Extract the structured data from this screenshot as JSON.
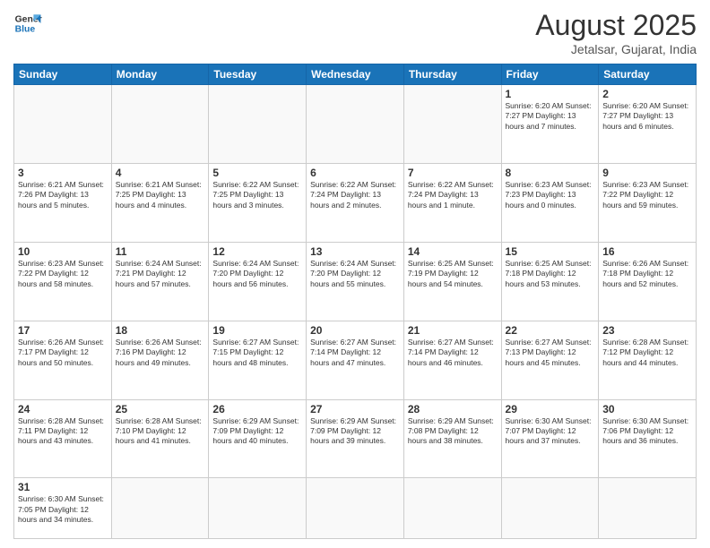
{
  "header": {
    "logo": {
      "general": "General",
      "blue": "Blue"
    },
    "title": "August 2025",
    "location": "Jetalsar, Gujarat, India"
  },
  "calendar": {
    "days_of_week": [
      "Sunday",
      "Monday",
      "Tuesday",
      "Wednesday",
      "Thursday",
      "Friday",
      "Saturday"
    ],
    "weeks": [
      [
        {
          "day": "",
          "info": ""
        },
        {
          "day": "",
          "info": ""
        },
        {
          "day": "",
          "info": ""
        },
        {
          "day": "",
          "info": ""
        },
        {
          "day": "",
          "info": ""
        },
        {
          "day": "1",
          "info": "Sunrise: 6:20 AM\nSunset: 7:27 PM\nDaylight: 13 hours and 7 minutes."
        },
        {
          "day": "2",
          "info": "Sunrise: 6:20 AM\nSunset: 7:27 PM\nDaylight: 13 hours and 6 minutes."
        }
      ],
      [
        {
          "day": "3",
          "info": "Sunrise: 6:21 AM\nSunset: 7:26 PM\nDaylight: 13 hours and 5 minutes."
        },
        {
          "day": "4",
          "info": "Sunrise: 6:21 AM\nSunset: 7:25 PM\nDaylight: 13 hours and 4 minutes."
        },
        {
          "day": "5",
          "info": "Sunrise: 6:22 AM\nSunset: 7:25 PM\nDaylight: 13 hours and 3 minutes."
        },
        {
          "day": "6",
          "info": "Sunrise: 6:22 AM\nSunset: 7:24 PM\nDaylight: 13 hours and 2 minutes."
        },
        {
          "day": "7",
          "info": "Sunrise: 6:22 AM\nSunset: 7:24 PM\nDaylight: 13 hours and 1 minute."
        },
        {
          "day": "8",
          "info": "Sunrise: 6:23 AM\nSunset: 7:23 PM\nDaylight: 13 hours and 0 minutes."
        },
        {
          "day": "9",
          "info": "Sunrise: 6:23 AM\nSunset: 7:22 PM\nDaylight: 12 hours and 59 minutes."
        }
      ],
      [
        {
          "day": "10",
          "info": "Sunrise: 6:23 AM\nSunset: 7:22 PM\nDaylight: 12 hours and 58 minutes."
        },
        {
          "day": "11",
          "info": "Sunrise: 6:24 AM\nSunset: 7:21 PM\nDaylight: 12 hours and 57 minutes."
        },
        {
          "day": "12",
          "info": "Sunrise: 6:24 AM\nSunset: 7:20 PM\nDaylight: 12 hours and 56 minutes."
        },
        {
          "day": "13",
          "info": "Sunrise: 6:24 AM\nSunset: 7:20 PM\nDaylight: 12 hours and 55 minutes."
        },
        {
          "day": "14",
          "info": "Sunrise: 6:25 AM\nSunset: 7:19 PM\nDaylight: 12 hours and 54 minutes."
        },
        {
          "day": "15",
          "info": "Sunrise: 6:25 AM\nSunset: 7:18 PM\nDaylight: 12 hours and 53 minutes."
        },
        {
          "day": "16",
          "info": "Sunrise: 6:26 AM\nSunset: 7:18 PM\nDaylight: 12 hours and 52 minutes."
        }
      ],
      [
        {
          "day": "17",
          "info": "Sunrise: 6:26 AM\nSunset: 7:17 PM\nDaylight: 12 hours and 50 minutes."
        },
        {
          "day": "18",
          "info": "Sunrise: 6:26 AM\nSunset: 7:16 PM\nDaylight: 12 hours and 49 minutes."
        },
        {
          "day": "19",
          "info": "Sunrise: 6:27 AM\nSunset: 7:15 PM\nDaylight: 12 hours and 48 minutes."
        },
        {
          "day": "20",
          "info": "Sunrise: 6:27 AM\nSunset: 7:14 PM\nDaylight: 12 hours and 47 minutes."
        },
        {
          "day": "21",
          "info": "Sunrise: 6:27 AM\nSunset: 7:14 PM\nDaylight: 12 hours and 46 minutes."
        },
        {
          "day": "22",
          "info": "Sunrise: 6:27 AM\nSunset: 7:13 PM\nDaylight: 12 hours and 45 minutes."
        },
        {
          "day": "23",
          "info": "Sunrise: 6:28 AM\nSunset: 7:12 PM\nDaylight: 12 hours and 44 minutes."
        }
      ],
      [
        {
          "day": "24",
          "info": "Sunrise: 6:28 AM\nSunset: 7:11 PM\nDaylight: 12 hours and 43 minutes."
        },
        {
          "day": "25",
          "info": "Sunrise: 6:28 AM\nSunset: 7:10 PM\nDaylight: 12 hours and 41 minutes."
        },
        {
          "day": "26",
          "info": "Sunrise: 6:29 AM\nSunset: 7:09 PM\nDaylight: 12 hours and 40 minutes."
        },
        {
          "day": "27",
          "info": "Sunrise: 6:29 AM\nSunset: 7:09 PM\nDaylight: 12 hours and 39 minutes."
        },
        {
          "day": "28",
          "info": "Sunrise: 6:29 AM\nSunset: 7:08 PM\nDaylight: 12 hours and 38 minutes."
        },
        {
          "day": "29",
          "info": "Sunrise: 6:30 AM\nSunset: 7:07 PM\nDaylight: 12 hours and 37 minutes."
        },
        {
          "day": "30",
          "info": "Sunrise: 6:30 AM\nSunset: 7:06 PM\nDaylight: 12 hours and 36 minutes."
        }
      ],
      [
        {
          "day": "31",
          "info": "Sunrise: 6:30 AM\nSunset: 7:05 PM\nDaylight: 12 hours and 34 minutes."
        },
        {
          "day": "",
          "info": ""
        },
        {
          "day": "",
          "info": ""
        },
        {
          "day": "",
          "info": ""
        },
        {
          "day": "",
          "info": ""
        },
        {
          "day": "",
          "info": ""
        },
        {
          "day": "",
          "info": ""
        }
      ]
    ]
  }
}
